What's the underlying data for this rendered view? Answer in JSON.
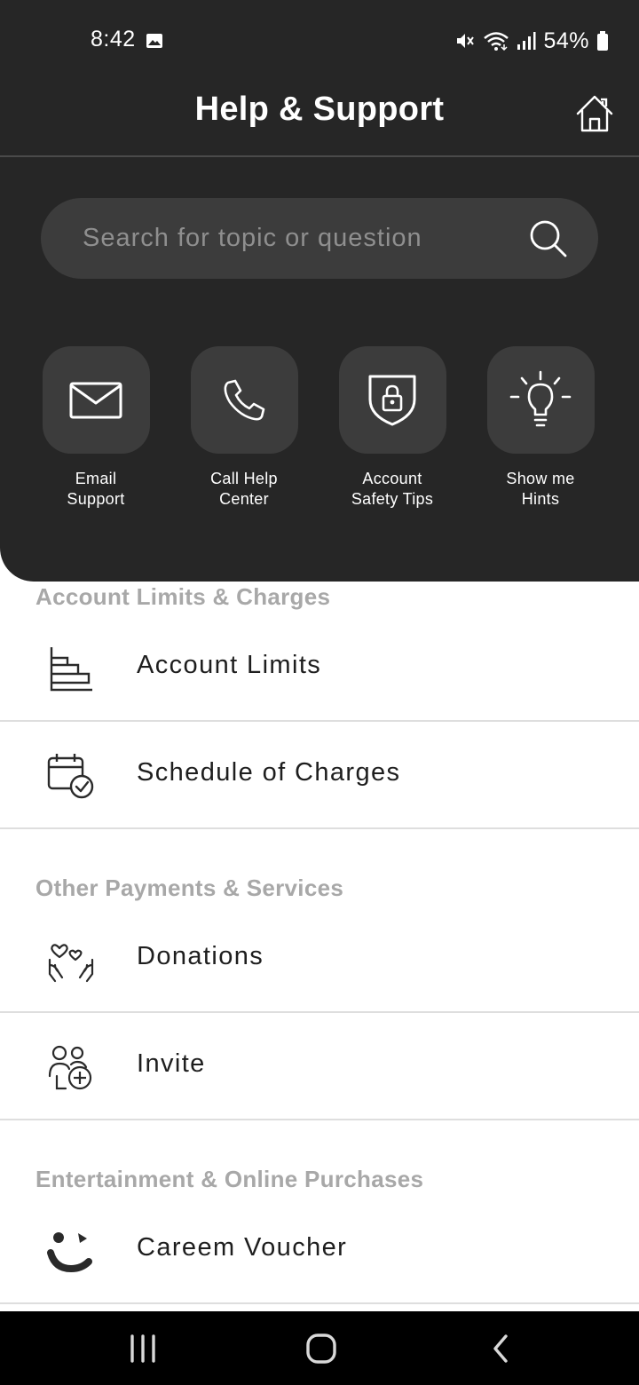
{
  "status_bar": {
    "time": "8:42",
    "battery": "54%",
    "icons": [
      "image-icon",
      "mute-icon",
      "wifi-icon",
      "signal-icon",
      "battery-icon"
    ]
  },
  "header": {
    "title": "Help & Support",
    "home_icon": "home-icon"
  },
  "search": {
    "placeholder": "Search for topic or question",
    "icon": "search-icon"
  },
  "quick_actions": [
    {
      "label": "Email Support",
      "icon": "envelope-icon"
    },
    {
      "label": "Call Help Center",
      "icon": "phone-icon"
    },
    {
      "label": "Account Safety Tips",
      "icon": "shield-lock-icon"
    },
    {
      "label": "Show me Hints",
      "icon": "lightbulb-icon"
    }
  ],
  "sections": [
    {
      "title": "Account Limits & Charges",
      "items": [
        {
          "label": "Account Limits",
          "icon": "bar-chart-icon"
        },
        {
          "label": "Schedule of Charges",
          "icon": "calendar-check-icon"
        }
      ]
    },
    {
      "title": "Other Payments & Services",
      "items": [
        {
          "label": "Donations",
          "icon": "hands-heart-icon"
        },
        {
          "label": "Invite",
          "icon": "add-person-icon"
        }
      ]
    },
    {
      "title": "Entertainment & Online Purchases",
      "items": [
        {
          "label": "Careem Voucher",
          "icon": "careem-logo-icon"
        }
      ]
    }
  ],
  "nav_bar": {
    "buttons": [
      "recents-icon",
      "home-nav-icon",
      "back-icon"
    ]
  },
  "colors": {
    "header_bg": "#262626",
    "tile_bg": "#3c3c3c",
    "section_title": "#a8a8a8",
    "item_text": "#1e1e1e"
  }
}
